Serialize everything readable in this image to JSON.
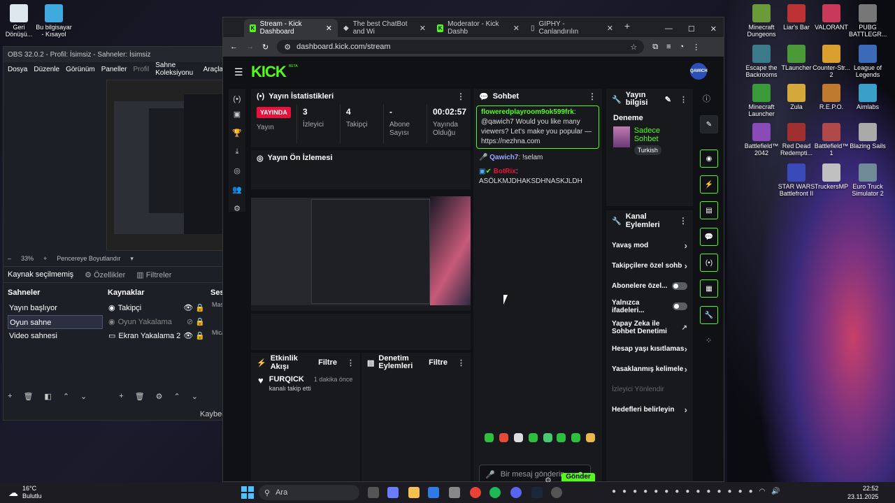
{
  "desktop": {
    "left_icons": [
      "Geri Dönüşü...",
      "Bu bilgisayar - Kısayol"
    ],
    "right_icons": [
      "Minecraft Dungeons",
      "Liar's Bar",
      "VALORANT",
      "PUBG BATTLEGR...",
      "Escape the Backrooms",
      "TLauncher",
      "Counter-Str... 2",
      "League of Legends",
      "Minecraft Launcher",
      "Zula",
      "R.E.P.O.",
      "Aimlabs",
      "Battlefield™ 2042",
      "Red Dead Redempti...",
      "Battlefield™ 1",
      "Blazing Sails",
      "STAR WARS Battlefront II",
      "TruckersMP",
      "Euro Truck Simulator 2"
    ]
  },
  "obs": {
    "title": "OBS 32.0.2 - Profil: İsimsiz - Sahneler: İsimsiz",
    "menu": [
      "Dosya",
      "Düzenle",
      "Görünüm",
      "Paneller",
      "Profil",
      "Sahne Koleksiyonu",
      "Araçla"
    ],
    "zoom": "33%",
    "fit": "Pencereye Boyutlandır",
    "no_source": "Kaynak seçilmemiş",
    "props": "Özellikler",
    "filters": "Filtreler",
    "scenes_title": "Sahneler",
    "scenes": [
      "Yayın başlıyor",
      "Oyun sahne",
      "Video sahnesi"
    ],
    "sources_title": "Kaynaklar",
    "sources": [
      "Takipçi",
      "Oyun Yakalama",
      "Ekran Yakalama 2"
    ],
    "audio_title": "Ses",
    "audio_items": [
      "Masa",
      "Mic/"
    ],
    "status": "Kaybedi"
  },
  "browser": {
    "tabs": [
      "Stream - Kick Dashboard",
      "The best ChatBot and Wi",
      "Moderator - Kick Dashb",
      "GIPHY - Canlandırılın"
    ],
    "url": "dashboard.kick.com/stream"
  },
  "kick": {
    "logo": "KICK",
    "beta": "BETA",
    "avatar": "QAWICH",
    "stats": {
      "title": "Yayın İstatistikleri",
      "live": "YAYINDA",
      "live_label": "Yayın",
      "viewers": "3",
      "viewers_label": "İzleyici",
      "followers": "4",
      "followers_label": "Takipçi",
      "subs": "-",
      "subs_label": "Abone Sayısı",
      "time": "00:02:57",
      "time_label": "Yayında Olduğu"
    },
    "preview_title": "Yayın Ön İzlemesi",
    "activity": {
      "title": "Etkinlik Akışı",
      "filter": "Filtre",
      "user": "FURQICK",
      "ago": "1 dakika önce",
      "text": "kanalı takip etti"
    },
    "moderation": {
      "title": "Denetim Eylemleri",
      "filter": "Filtre"
    },
    "chat": {
      "title": "Sohbet",
      "msg1_user": "floweredplayroom9ok599frk",
      "msg1_text": "@qawich7 Would you like many viewers? Let's make you popular — https://nezhna.com",
      "msg2_user": "Qawich7",
      "msg2_text": "!selam",
      "msg3_user": "BotRix",
      "msg3_text": "ASÖLKMJDHAKSDHNASKJLDH",
      "placeholder": "Bir mesaj gönderin",
      "send": "Gönder"
    },
    "info": {
      "title": "Yayın bilgisi",
      "stream_title": "Deneme",
      "category": "Sadece Sohbet",
      "tag": "Turkish"
    },
    "actions": {
      "title": "Kanal Eylemleri",
      "items": [
        "Yavaş mod",
        "Takipçilere özel sohb",
        "Abonelere özel...",
        "Yalnızca ifadeleri...",
        "Yapay Zeka ile Sohbet Denetimi",
        "Hesap yaşı kısıtlamas",
        "Yasaklanmış kelimele",
        "İzleyici Yönlendir",
        "Hedefleri belirleyin"
      ]
    }
  },
  "taskbar": {
    "temp": "16°C",
    "weather": "Bulutlu",
    "search": "Ara",
    "time": "22:52",
    "date": "23.11.2025"
  },
  "colors": {
    "kick_green": "#53fc18",
    "live_red": "#e9113c",
    "page_bg": "#0f1114"
  }
}
